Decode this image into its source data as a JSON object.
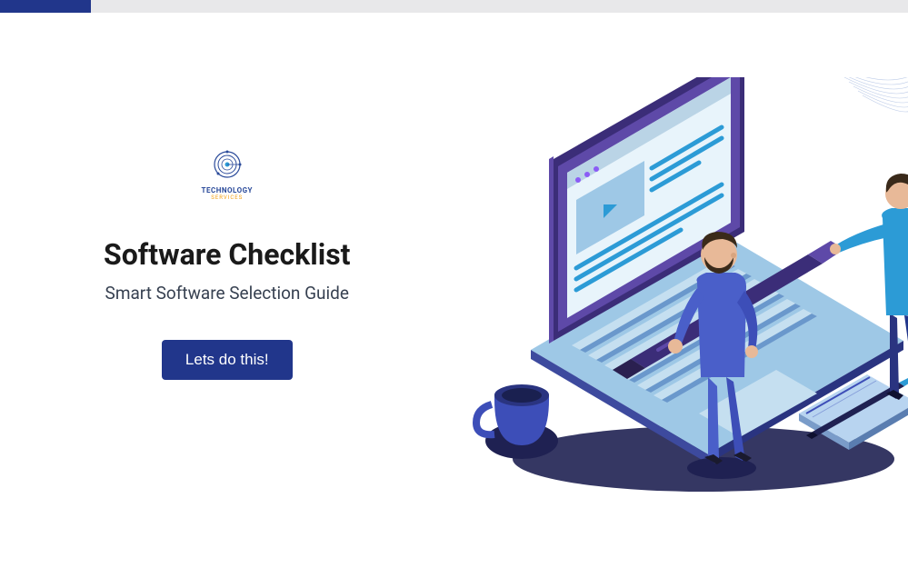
{
  "logo": {
    "line1": "TECHNOLOGY",
    "line2": "SERVICES"
  },
  "heading": "Software Checklist",
  "subheading": "Smart Software Selection Guide",
  "cta_label": "Lets do this!",
  "colors": {
    "primary": "#21368b",
    "accent_purple": "#553c9a",
    "accent_blue": "#2c9bd6"
  }
}
